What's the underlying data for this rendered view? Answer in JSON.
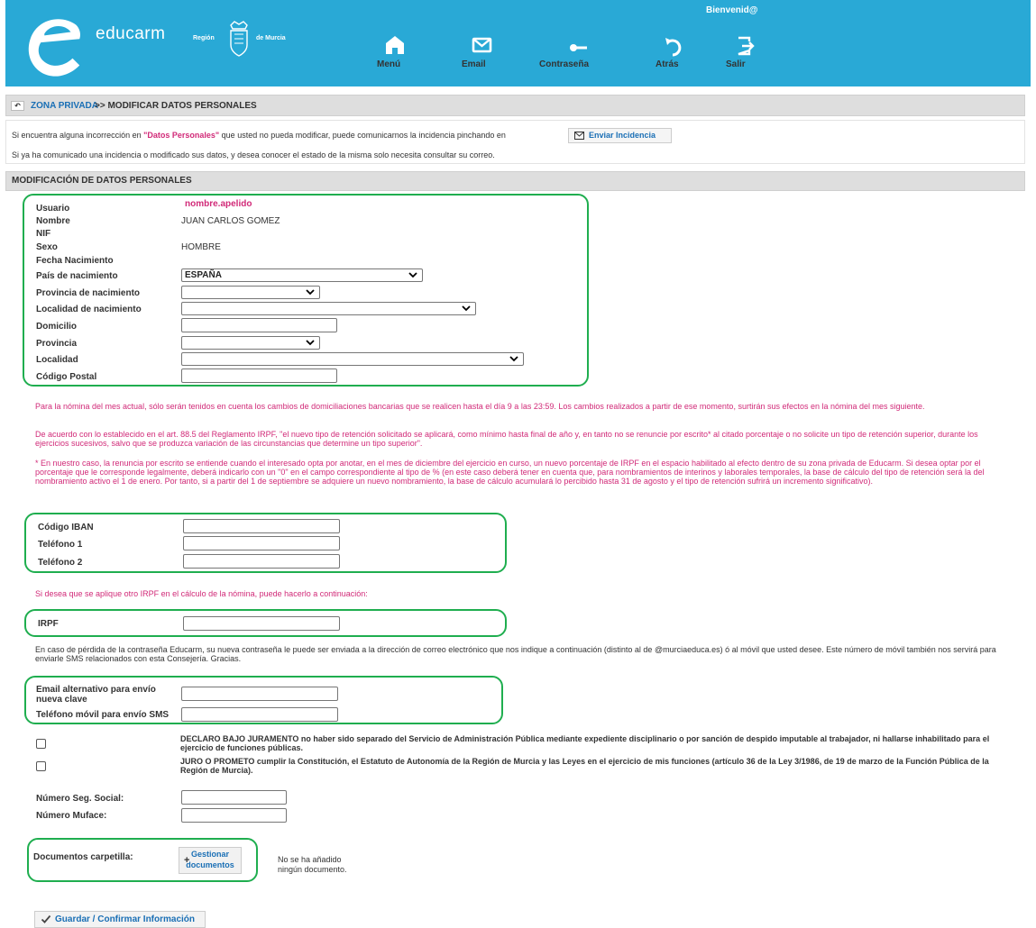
{
  "header": {
    "brand": "educarm",
    "region_left": "Región",
    "region_right": "de Murcia",
    "welcome": "Bienvenid@",
    "nav": [
      {
        "label": "Menú",
        "icon": "home-icon"
      },
      {
        "label": "Email",
        "icon": "envelope-icon"
      },
      {
        "label": "Contraseña",
        "icon": "key-icon"
      },
      {
        "label": "Atrás",
        "icon": "undo-arrow-icon"
      },
      {
        "label": "Salir",
        "icon": "exit-icon"
      }
    ]
  },
  "breadcrumb": {
    "link": "ZONA PRIVADA",
    "current": ">> MODIFICAR DATOS PERSONALES"
  },
  "info": {
    "line1_pre": "Si encuentra alguna incorrección en ",
    "line1_highlight": "\"Datos Personales\"",
    "line1_post": " que usted no pueda modificar, puede comunicarnos la incidencia pinchando en",
    "incidence_button": "Enviar Incidencia",
    "line2": "Si ya ha comunicado una incidencia o modificado sus datos, y desea conocer el estado de la misma solo necesita consultar su correo."
  },
  "section_title": "MODIFICACIÓN DE DATOS PERSONALES",
  "personal": {
    "usuario_label": "Usuario",
    "usuario_value": "nombre.apelido",
    "nombre_label": "Nombre",
    "nombre_value": "JUAN CARLOS GOMEZ",
    "nif_label": "NIF",
    "sexo_label": "Sexo",
    "sexo_value": "HOMBRE",
    "fecha_label": "Fecha Nacimiento",
    "pais_label": "País de nacimiento",
    "pais_value": "ESPAÑA",
    "prov_nac_label": "Provincia de nacimiento",
    "loc_nac_label": "Localidad de nacimiento",
    "domicilio_label": "Domicilio",
    "provincia_label": "Provincia",
    "localidad_label": "Localidad",
    "cp_label": "Código Postal"
  },
  "notices": {
    "nomina": "Para la nómina del mes actual, sólo serán tenidos en cuenta los cambios de domiciliaciones bancarias que se realicen hasta el día 9 a las 23:59. Los cambios realizados a partir de ese momento, surtirán sus efectos en la nómina del mes siguiente.",
    "irpf_rule": "De acuerdo con lo establecido en el art. 88.5 del Reglamento IRPF, \"el nuevo tipo de retención solicitado se aplicará, como mínimo hasta final de año y, en tanto no se renuncie por escrito* al citado porcentaje o no solicite un tipo de retención superior, durante los ejercicios sucesivos, salvo que se produzca variación de las circunstancias que determine un tipo superior\".",
    "renuncia": "* En nuestro caso, la renuncia por escrito se entiende cuando el interesado opta por anotar, en el mes de diciembre del ejercicio en curso, un nuevo porcentaje de IRPF en el espacio habilitado al efecto dentro de su zona privada de Educarm. Si desea optar por el porcentaje que le corresponde legalmente, deberá indicarlo con un \"0\" en el campo correspondiente al tipo de % (en este caso deberá tener en cuenta que, para nombramientos de interinos y laborales temporales, la base de cálculo del tipo de retención será la del nombramiento activo el 1 de enero. Por tanto, si a partir del 1 de septiembre se adquiere un nuevo nombramiento, la base de cálculo acumulará lo percibido hasta 31 de agosto y el tipo de retención sufrirá un incremento significativo).",
    "irpf_prompt": "Si desea que se aplique otro IRPF en el cálculo de la nómina, puede hacerlo a continuación:",
    "password": "En caso de pérdida de la contraseña Educarm, su nueva contraseña le puede ser enviada a la dirección de correo electrónico que nos indique a continuación (distinto al de @murciaeduca.es) ó al móvil que usted desee. Este número de móvil también nos servirá para enviarle SMS relacionados con esta Consejería. Gracias."
  },
  "bank": {
    "iban_label": "Código IBAN",
    "tel1_label": "Teléfono 1",
    "tel2_label": "Teléfono 2",
    "irpf_label": "IRPF"
  },
  "recovery": {
    "email_label_1": "Email alternativo para envío",
    "email_label_2": "nueva clave",
    "sms_label": "Teléfono móvil para envío SMS"
  },
  "declarations": {
    "d1": "DECLARO BAJO JURAMENTO no haber sido separado del Servicio de Administración Pública mediante expediente disciplinario o por sanción de despido imputable al trabajador, ni hallarse inhabilitado para el ejercicio de funciones públicas.",
    "d2": "JURO O PROMETO cumplir la Constitución, el Estatuto de Autonomía de la Región de Murcia y las Leyes en el ejercicio de mis funciones (artículo 36 de la Ley 3/1986, de 19 de marzo de la Función Pública de la Región de Murcia)."
  },
  "social": {
    "ss_label": "Número Seg. Social:",
    "muface_label": "Número Muface:"
  },
  "documents": {
    "label": "Documentos carpetilla:",
    "button_line1": "Gestionar",
    "button_line2": "documentos",
    "empty_line1": "No se ha añadido",
    "empty_line2": "ningún documento."
  },
  "save_button": "Guardar / Confirmar Información",
  "colors": {
    "header": "#29a9d6",
    "highlight": "#d12a78",
    "link": "#1a6fb5",
    "frame": "#1fae4f"
  }
}
